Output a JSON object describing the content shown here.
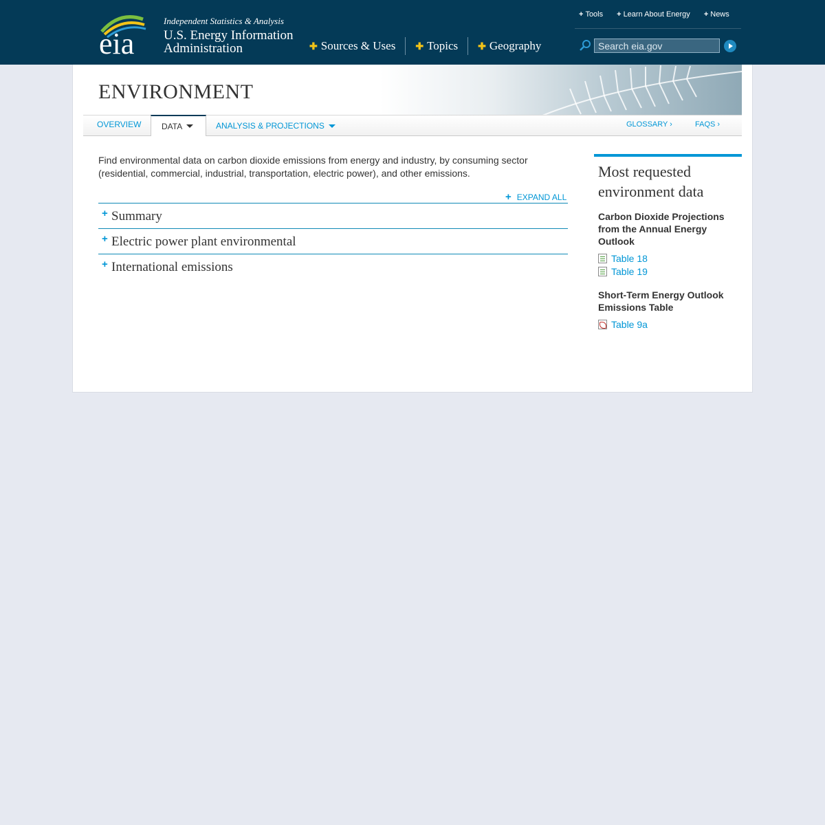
{
  "header": {
    "tagline": "Independent Statistics & Analysis",
    "agency_name": "U.S. Energy Information Administration",
    "logo_text": "eia",
    "top_links": [
      {
        "label": "Tools"
      },
      {
        "label": "Learn About Energy"
      },
      {
        "label": "News"
      }
    ],
    "main_nav": [
      {
        "label": "Sources & Uses"
      },
      {
        "label": "Topics"
      },
      {
        "label": "Geography"
      }
    ],
    "search": {
      "placeholder": "Search eia.gov",
      "value": ""
    },
    "colors": {
      "bar": "#043a57",
      "accent_plus": "#f2c318"
    }
  },
  "page": {
    "title": "ENVIRONMENT",
    "tabs": [
      {
        "label": "OVERVIEW",
        "active": false
      },
      {
        "label": "DATA",
        "active": true
      },
      {
        "label": "ANALYSIS & PROJECTIONS",
        "active": false
      }
    ],
    "right_links": [
      {
        "label": "GLOSSARY ›"
      },
      {
        "label": "FAQS ›"
      }
    ],
    "intro": "Find environmental data on carbon dioxide emissions from energy and industry, by consuming sector (residential, commercial, industrial, transportation, electric power), and other emissions.",
    "expand_all": "EXPAND ALL",
    "sections": [
      {
        "label": "Summary"
      },
      {
        "label": "Electric power plant environmental"
      },
      {
        "label": "International emissions"
      }
    ]
  },
  "sidebar": {
    "title": "Most requested environment data",
    "groups": [
      {
        "heading": "Carbon Dioxide Projections from the Annual Energy Outlook",
        "links": [
          {
            "label": "Table 18",
            "icon": "xls-file-icon"
          },
          {
            "label": "Table 19",
            "icon": "xls-file-icon"
          }
        ]
      },
      {
        "heading": "Short-Term Energy Outlook Emissions Table",
        "links": [
          {
            "label": "Table 9a",
            "icon": "pdf-file-icon"
          }
        ]
      }
    ],
    "accent_color": "#0096d6"
  }
}
